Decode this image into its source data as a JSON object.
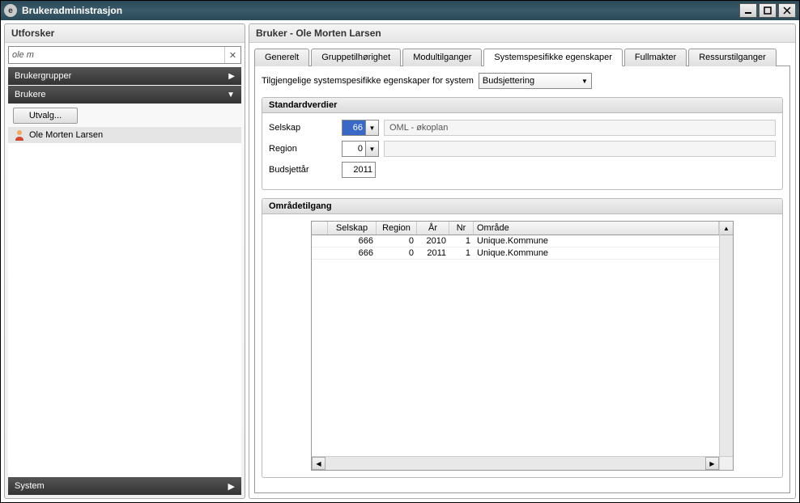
{
  "window": {
    "title": "Brukeradministrasjon"
  },
  "sidebar": {
    "title": "Utforsker",
    "search_value": "ole m",
    "nav_groups": "Brukergrupper",
    "nav_users": "Brukere",
    "utvalg_btn": "Utvalg...",
    "users": [
      {
        "name": "Ole Morten Larsen"
      }
    ],
    "system_bar": "System"
  },
  "content": {
    "title": "Bruker - Ole Morten Larsen",
    "tabs": [
      {
        "label": "Generelt"
      },
      {
        "label": "Gruppetilhørighet"
      },
      {
        "label": "Modultilganger"
      },
      {
        "label": "Systemspesifikke egenskaper",
        "active": true
      },
      {
        "label": "Fullmakter"
      },
      {
        "label": "Ressurstilganger"
      }
    ],
    "system_select_label": "Tilgjengelige systemspesifikke egenskaper for system",
    "system_select_value": "Budsjettering",
    "standard": {
      "legend": "Standardverdier",
      "selskap_label": "Selskap",
      "selskap_value": "66",
      "selskap_desc": "OML - økoplan",
      "region_label": "Region",
      "region_value": "0",
      "budsjettar_label": "Budsjettår",
      "budsjettar_value": "2011"
    },
    "omrade": {
      "legend": "Områdetilgang",
      "columns": [
        "",
        "Selskap",
        "Region",
        "År",
        "Nr",
        "Område"
      ],
      "rows": [
        {
          "selskap": "666",
          "region": "0",
          "ar": "2010",
          "nr": "1",
          "omrade": "Unique.Kommune"
        },
        {
          "selskap": "666",
          "region": "0",
          "ar": "2011",
          "nr": "1",
          "omrade": "Unique.Kommune"
        }
      ]
    }
  }
}
